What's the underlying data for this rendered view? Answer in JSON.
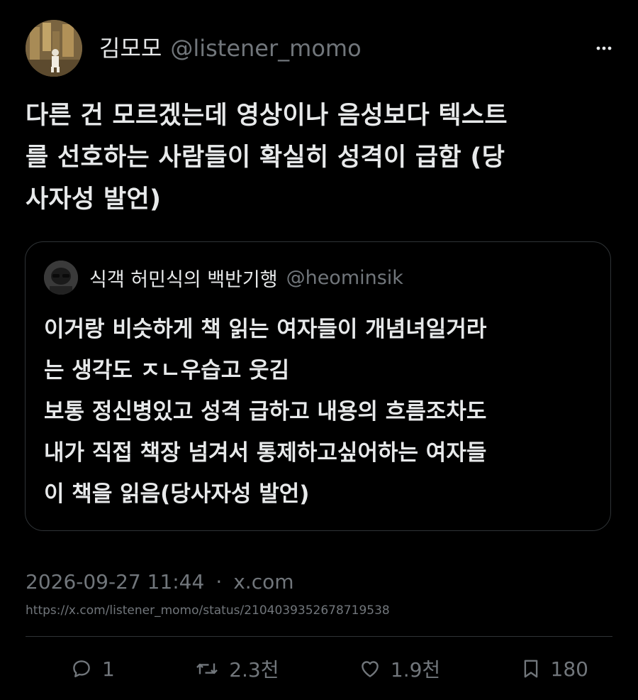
{
  "author": {
    "display_name": "김모모",
    "handle": "@listener_momo",
    "avatar_icon": "avatar-illustration"
  },
  "tweet": {
    "text": "다른 건 모르겠는데 영상이나 음성보다 텍스트\n를 선호하는 사람들이 확실히 성격이 급함 (당\n사자성 발언)"
  },
  "quoted_tweet": {
    "display_name": "식객 허민식의 백반기행",
    "handle": "@heominsik",
    "text": "이거랑 비슷하게 책 읽는 여자들이 개념녀일거라\n는 생각도 ㅈㄴ우습고 웃김\n보통 정신병있고 성격 급하고 내용의 흐름조차도\n내가 직접 책장 넘겨서 통제하고싶어하는 여자들\n이 책을 읽음(당사자성 발언)"
  },
  "meta": {
    "timestamp": "2026-09-27 11:44",
    "separator": "·",
    "source": "x.com",
    "url": "https://x.com/listener_momo/status/2104039352678719538"
  },
  "actions": {
    "replies": "1",
    "reposts": "2.3천",
    "likes": "1.9천",
    "bookmarks": "180"
  },
  "colors": {
    "background": "#000000",
    "primary_text": "#e7e9ea",
    "secondary_text": "#71767b",
    "border": "#2f3336"
  }
}
